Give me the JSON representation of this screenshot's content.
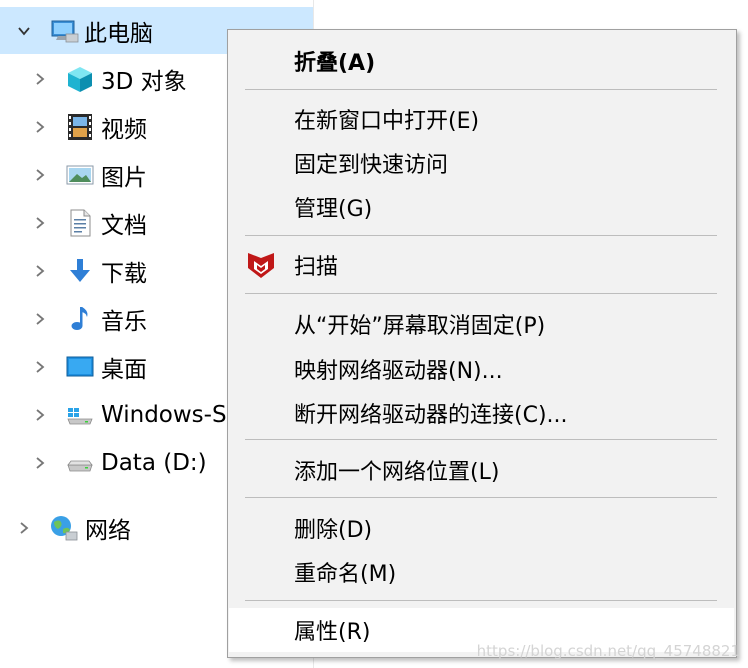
{
  "tree": {
    "this_pc": "此电脑",
    "items": [
      {
        "label": "3D 对象",
        "icon": "3d-objects-icon"
      },
      {
        "label": "视频",
        "icon": "videos-icon"
      },
      {
        "label": "图片",
        "icon": "pictures-icon"
      },
      {
        "label": "文档",
        "icon": "documents-icon"
      },
      {
        "label": "下载",
        "icon": "downloads-icon"
      },
      {
        "label": "音乐",
        "icon": "music-icon"
      },
      {
        "label": "桌面",
        "icon": "desktop-icon"
      },
      {
        "label": "Windows-S",
        "icon": "windows-drive-icon"
      },
      {
        "label": "Data (D:)",
        "icon": "drive-icon"
      }
    ],
    "network": "网络"
  },
  "menu": {
    "collapse": "折叠(A)",
    "open_new_window": "在新窗口中打开(E)",
    "pin_quick_access": "固定到快速访问",
    "manage": "管理(G)",
    "scan": "扫描",
    "unpin_start": "从“开始”屏幕取消固定(P)",
    "map_drive": "映射网络驱动器(N)...",
    "disconnect_drive": "断开网络驱动器的连接(C)...",
    "add_network_location": "添加一个网络位置(L)",
    "delete": "删除(D)",
    "rename": "重命名(M)",
    "properties": "属性(R)"
  },
  "colors": {
    "selection": "#cce8ff",
    "menu_bg": "#f2f2f2",
    "mcafee_red": "#c01818"
  },
  "watermark": "https://blog.csdn.net/qq_45748821"
}
